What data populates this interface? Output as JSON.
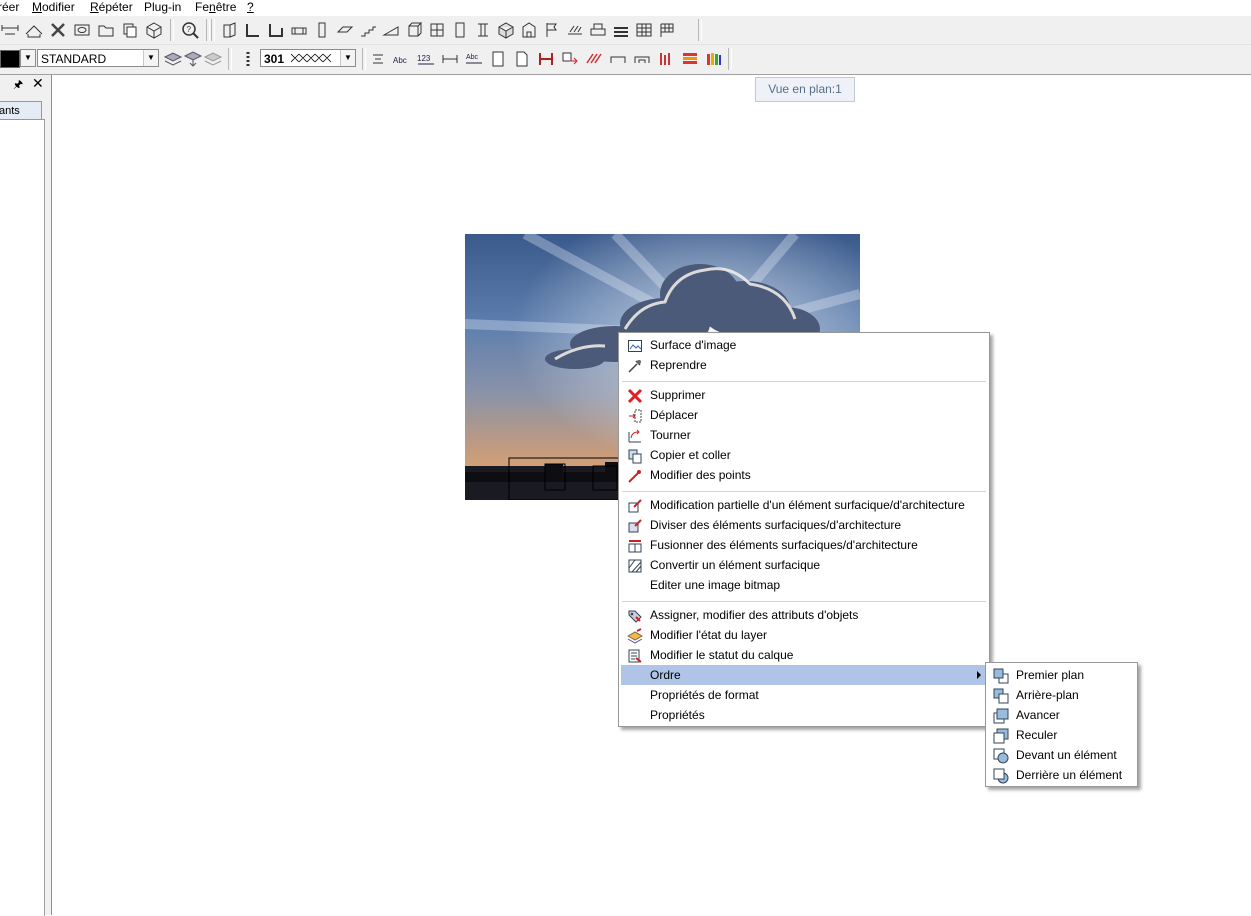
{
  "menubar": {
    "items": [
      "réer",
      "Modifier",
      "Répéter",
      "Plug-in",
      "Fenêtre",
      "?"
    ]
  },
  "toolbar2": {
    "style_value": "STANDARD",
    "hatch_value": "301"
  },
  "left_panel": {
    "tab_label": "ants",
    "pin_icon": "pin-icon",
    "close_glyph": "✕"
  },
  "view": {
    "label": "Vue en plan:1"
  },
  "context_menu": {
    "items": [
      {
        "label": "Surface d'image",
        "icon": "image-surface-icon"
      },
      {
        "label": "Reprendre",
        "icon": "eyedropper-icon"
      },
      {
        "label": "Supprimer",
        "icon": "delete-x-icon"
      },
      {
        "label": "Déplacer",
        "icon": "move-icon"
      },
      {
        "label": "Tourner",
        "icon": "rotate-icon"
      },
      {
        "label": "Copier et coller",
        "icon": "copy-icon"
      },
      {
        "label": "Modifier des points",
        "icon": "edit-points-icon"
      },
      {
        "label": "Modification partielle d'un élément surfacique/d'architecture",
        "icon": "partial-modify-icon"
      },
      {
        "label": "Diviser des éléments surfaciques/d'architecture",
        "icon": "split-icon"
      },
      {
        "label": "Fusionner des éléments surfaciques/d'architecture",
        "icon": "merge-icon"
      },
      {
        "label": "Convertir un élément surfacique",
        "icon": "convert-icon"
      },
      {
        "label": "Editer une image bitmap",
        "icon": ""
      },
      {
        "label": "Assigner, modifier des attributs d'objets",
        "icon": "attributes-icon"
      },
      {
        "label": "Modifier l'état du layer",
        "icon": "layer-state-icon"
      },
      {
        "label": "Modifier le statut du calque",
        "icon": "layer-status-icon"
      },
      {
        "label": "Ordre",
        "icon": "",
        "has_submenu": true
      },
      {
        "label": "Propriétés de format",
        "icon": ""
      },
      {
        "label": "Propriétés",
        "icon": ""
      }
    ],
    "highlight_color": "#b0c4e8"
  },
  "submenu_ordre": {
    "items": [
      {
        "label": "Premier plan",
        "icon": "bring-to-front-icon"
      },
      {
        "label": "Arrière-plan",
        "icon": "send-to-back-icon"
      },
      {
        "label": "Avancer",
        "icon": "bring-forward-icon"
      },
      {
        "label": "Reculer",
        "icon": "send-backward-icon"
      },
      {
        "label": "Devant un élément",
        "icon": "in-front-of-element-icon"
      },
      {
        "label": "Derrière un élément",
        "icon": "behind-element-icon"
      }
    ]
  }
}
